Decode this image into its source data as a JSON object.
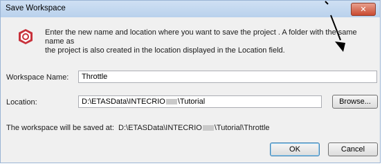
{
  "dialog": {
    "title": "Save Workspace",
    "close_label": "✕",
    "info_line1": "Enter the new name and location where you want to save the project . A folder with the same name as",
    "info_line2": "the project is also created in the location displayed in the Location field."
  },
  "form": {
    "name_label": "Workspace Name:",
    "name_value": "Throttle",
    "location_label": "Location:",
    "location_prefix": "D:\\ETASData\\INTECRIO",
    "location_suffix": "\\Tutorial",
    "browse_label": "Browse...",
    "saved_at_label": "The workspace will be saved at:",
    "saved_at_prefix": "D:\\ETASData\\INTECRIO",
    "saved_at_suffix": "\\Tutorial\\Throttle"
  },
  "buttons": {
    "ok_label": "OK",
    "cancel_label": "Cancel"
  },
  "colors": {
    "titlebar": "#b9d1ec",
    "close_button": "#c94a31",
    "dialog_background": "#f0f0f0",
    "icon_accent": "#c8323c"
  },
  "icons": {
    "app": "workspace-app-icon",
    "close": "close-icon",
    "annotation": "arrow-annotation-icon"
  }
}
